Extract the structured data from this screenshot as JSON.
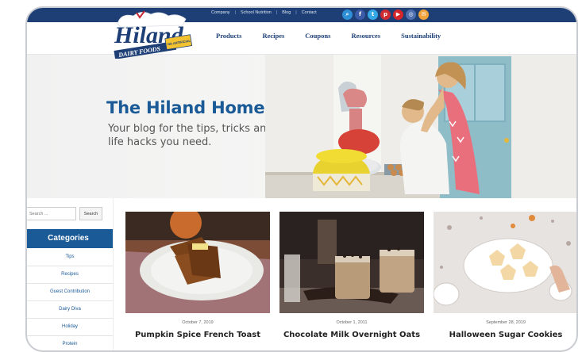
{
  "brand": {
    "logo_text": "Hiland",
    "logo_sub": "DAIRY FOODS",
    "logo_badge": "NO ARTIFICIAL"
  },
  "colors": {
    "navy": "#1d3f76",
    "blue": "#1a5a97",
    "white": "#ffffff"
  },
  "top_links": [
    "Company",
    "School Nutrition",
    "Blog",
    "Contact"
  ],
  "social": [
    {
      "icon": "search-icon",
      "glyph": "⌕",
      "color": "#2e8fd6"
    },
    {
      "icon": "facebook-icon",
      "glyph": "f",
      "color": "#3b5ba8"
    },
    {
      "icon": "twitter-icon",
      "glyph": "t",
      "color": "#36a8e8"
    },
    {
      "icon": "pinterest-icon",
      "glyph": "p",
      "color": "#cf2c32"
    },
    {
      "icon": "youtube-icon",
      "glyph": "▶",
      "color": "#d4262a"
    },
    {
      "icon": "instagram-icon",
      "glyph": "◎",
      "color": "#4f6fb0"
    },
    {
      "icon": "email-icon",
      "glyph": "✉",
      "color": "#f2a23a"
    }
  ],
  "main_nav": [
    "Products",
    "Recipes",
    "Coupons",
    "Resources",
    "Sustainability"
  ],
  "hero": {
    "title": "The Hiland Home",
    "subtitle": "Your blog for the tips, tricks and life hacks you need."
  },
  "search": {
    "placeholder": "Search ...",
    "button_label": "Search"
  },
  "categories": {
    "heading": "Categories",
    "items": [
      "Tips",
      "Recipes",
      "Guest Contribution",
      "Dairy Diva",
      "Holiday",
      "Protein"
    ]
  },
  "posts": [
    {
      "date": "October 7, 2019",
      "title": "Pumpkin Spice French Toast"
    },
    {
      "date": "October 1, 2011",
      "title": "Chocolate Milk Overnight Oats"
    },
    {
      "date": "September 28, 2019",
      "title": "Halloween Sugar Cookies"
    }
  ]
}
